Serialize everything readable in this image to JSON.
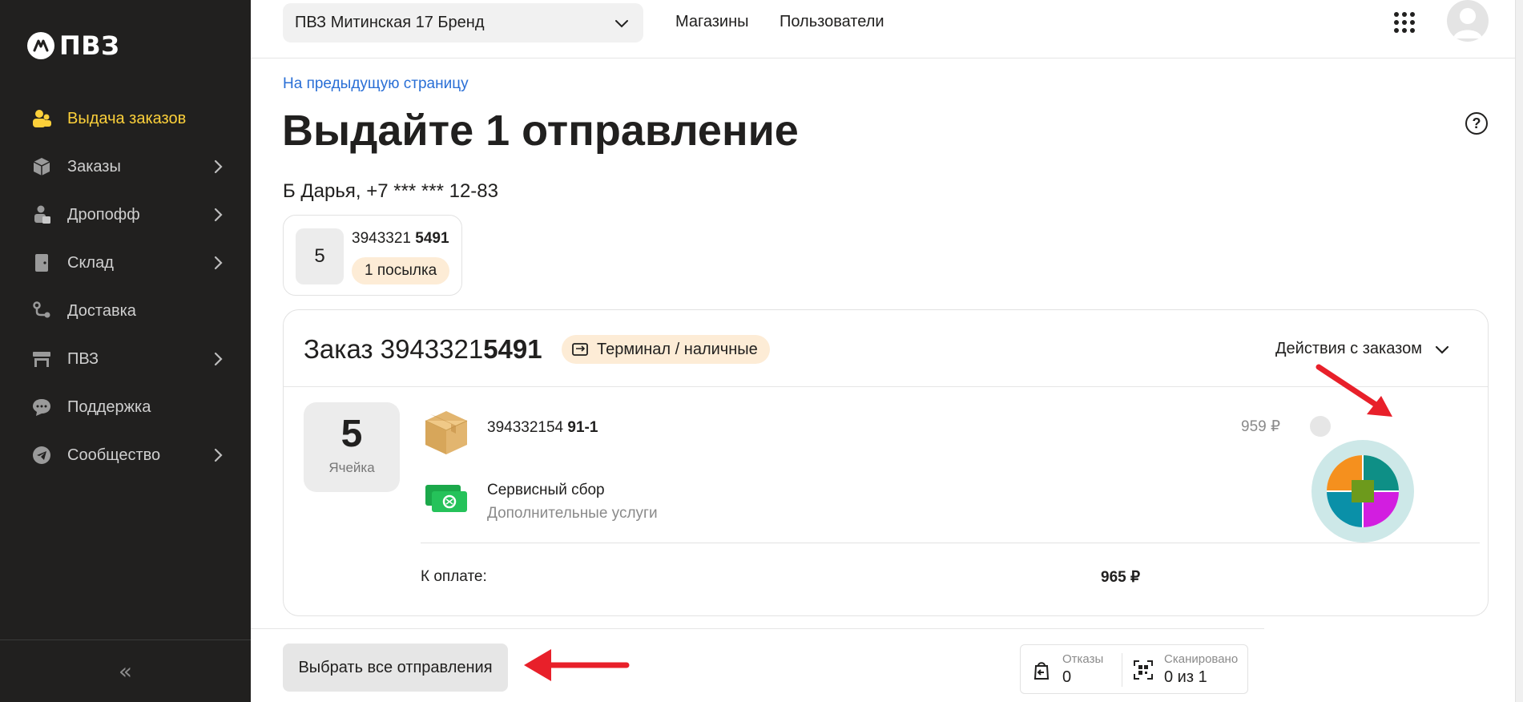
{
  "sidebar": {
    "logo_text": "ПВЗ",
    "items": [
      {
        "label": "Выдача заказов",
        "icon": "people-icon",
        "active": true,
        "has_chevron": false
      },
      {
        "label": "Заказы",
        "icon": "box-icon",
        "active": false,
        "has_chevron": true
      },
      {
        "label": "Дропофф",
        "icon": "dropoff-icon",
        "active": false,
        "has_chevron": true
      },
      {
        "label": "Склад",
        "icon": "door-icon",
        "active": false,
        "has_chevron": true
      },
      {
        "label": "Доставка",
        "icon": "route-icon",
        "active": false,
        "has_chevron": false
      },
      {
        "label": "ПВЗ",
        "icon": "store-icon",
        "active": false,
        "has_chevron": true
      },
      {
        "label": "Поддержка",
        "icon": "chat-icon",
        "active": false,
        "has_chevron": false
      },
      {
        "label": "Сообщество",
        "icon": "telegram-icon",
        "active": false,
        "has_chevron": true
      }
    ],
    "collapse_label": "«",
    "active_color": "#fcd03a"
  },
  "topbar": {
    "pvz_select": "ПВЗ Митинская 17 Бренд",
    "links": [
      "Магазины",
      "Пользователи"
    ]
  },
  "page": {
    "back_link": "На предыдущую страницу",
    "title": "Выдайте 1 отправление",
    "customer": "Б Дарья, +7 *** *** 12-83",
    "help_icon": "?"
  },
  "shipment": {
    "cell": "5",
    "number_prefix": "3943321",
    "number_suffix": "5491",
    "badge": "1 посылка"
  },
  "order": {
    "title_prefix": "Заказ 3943321",
    "title_suffix": "5491",
    "payment_badge": "Терминал / наличные",
    "actions_label": "Действия с заказом",
    "cell_number": "5",
    "cell_label": "Ячейка",
    "items": [
      {
        "number_prefix": "394332154",
        "number_suffix": "91-1",
        "price": "959 ₽"
      },
      {
        "title": "Сервисный сбор",
        "subtitle": "Дополнительные услуги"
      }
    ],
    "total_label": "К оплате:",
    "total_value": "965 ₽"
  },
  "bottom": {
    "select_all": "Выбрать все отправления",
    "refusals_label": "Отказы",
    "refusals_value": "0",
    "scanned_label": "Сканировано",
    "scanned_value": "0 из 1"
  }
}
